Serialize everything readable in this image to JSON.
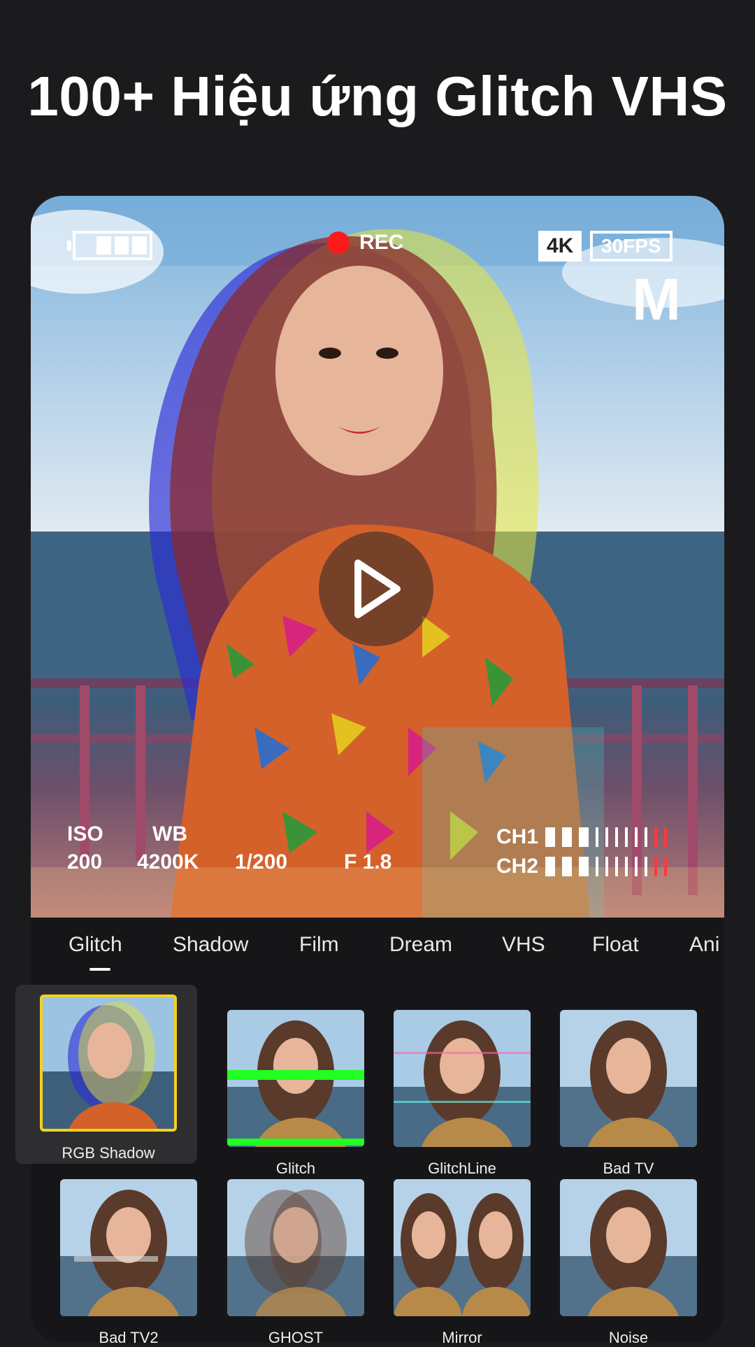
{
  "headline": "100+ Hiệu ứng Glitch VHS",
  "preview": {
    "rec_label": "REC",
    "resolution_badge": "4K",
    "fps_badge": "30FPS",
    "mode_letter": "M",
    "battery_level": 0.75,
    "stats": {
      "iso_label": "ISO",
      "iso_value": "200",
      "wb_label": "WB",
      "wb_value": "4200K",
      "shutter_value": "1/200",
      "aperture_value": "F 1.8"
    },
    "channels": [
      {
        "label": "CH1",
        "level": 0.3
      },
      {
        "label": "CH2",
        "level": 0.3
      }
    ]
  },
  "tabs": [
    "Glitch",
    "Shadow",
    "Film",
    "Dream",
    "VHS",
    "Float",
    "Ani"
  ],
  "active_tab": "Glitch",
  "effects": [
    {
      "label": "RGB Shadow",
      "selected": true
    },
    {
      "label": "Glitch",
      "selected": false
    },
    {
      "label": "GlitchLine",
      "selected": false
    },
    {
      "label": "Bad TV",
      "selected": false
    },
    {
      "label": "Bad TV2",
      "selected": false
    },
    {
      "label": "GHOST",
      "selected": false
    },
    {
      "label": "Mirror",
      "selected": false
    },
    {
      "label": "Noise",
      "selected": false
    }
  ],
  "colors": {
    "background": "#1b1b1d",
    "rec_dot": "#ff1a1a",
    "selection_outline": "#f5d020",
    "glitch_line": "#22ff22"
  }
}
